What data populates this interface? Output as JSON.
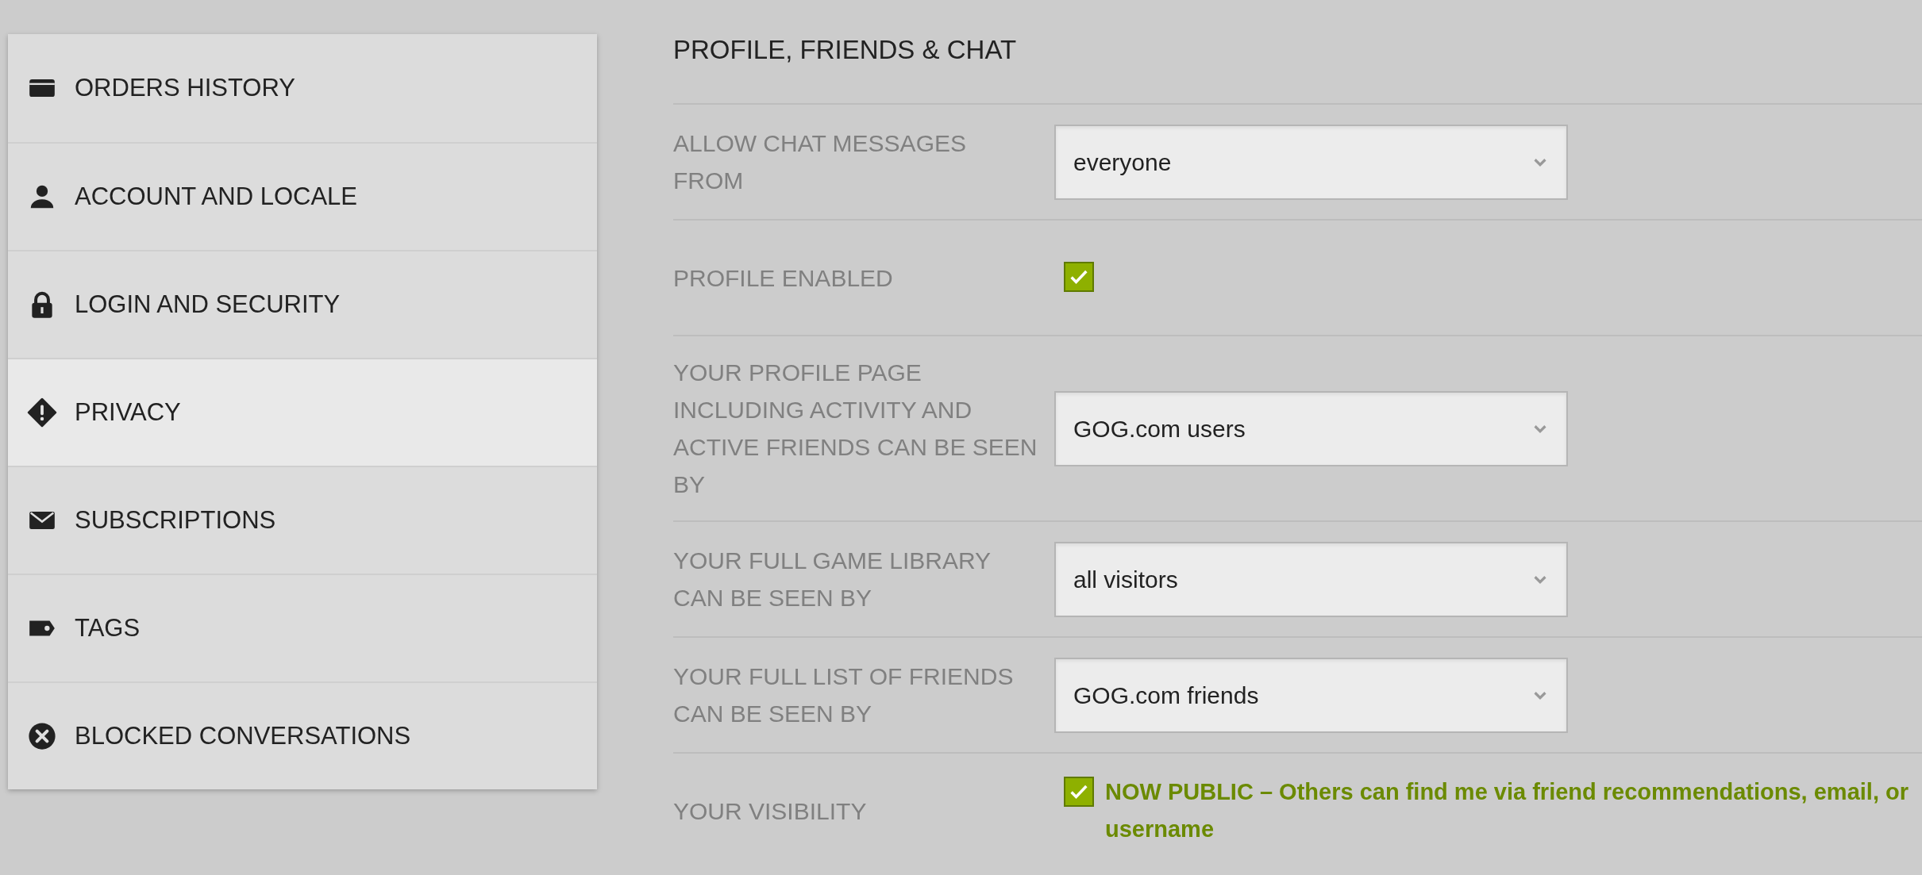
{
  "sidebar": {
    "items": [
      {
        "label": "ORDERS HISTORY",
        "selected": false
      },
      {
        "label": "ACCOUNT AND LOCALE",
        "selected": false
      },
      {
        "label": "LOGIN AND SECURITY",
        "selected": false
      },
      {
        "label": "PRIVACY",
        "selected": true
      },
      {
        "label": "SUBSCRIPTIONS",
        "selected": false
      },
      {
        "label": "TAGS",
        "selected": false
      },
      {
        "label": "BLOCKED CONVERSATIONS",
        "selected": false
      }
    ]
  },
  "section": {
    "title": "PROFILE, FRIENDS & CHAT",
    "rows": [
      {
        "kind": "select",
        "label": "ALLOW CHAT MESSAGES FROM",
        "value": "everyone"
      },
      {
        "kind": "checkbox",
        "label": "PROFILE ENABLED",
        "checked": true
      },
      {
        "kind": "select",
        "label": "YOUR PROFILE PAGE INCLUDING ACTIVITY AND ACTIVE FRIENDS CAN BE SEEN BY",
        "value": "GOG.com users"
      },
      {
        "kind": "select",
        "label": "YOUR FULL GAME LIBRARY CAN BE SEEN BY",
        "value": "all visitors"
      },
      {
        "kind": "select",
        "label": "YOUR FULL LIST OF FRIENDS CAN BE SEEN BY",
        "value": "GOG.com friends"
      },
      {
        "kind": "checkbox",
        "label": "YOUR VISIBILITY",
        "checked": true,
        "text": "NOW PUBLIC – Others can find me via friend recommendations, email, or username"
      }
    ]
  }
}
